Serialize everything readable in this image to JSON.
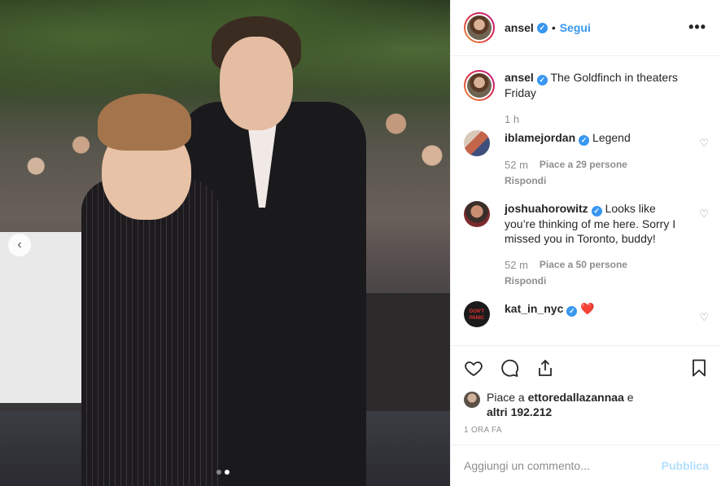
{
  "post": {
    "username": "ansel",
    "verified": true,
    "follow_label": "Segui",
    "bullet": "•",
    "more_label": "•••"
  },
  "caption": {
    "username": "ansel",
    "text": "The Goldfinch in theaters Friday",
    "time": "1 h"
  },
  "comments": [
    {
      "username": "iblamejordan",
      "verified": true,
      "text": "Legend",
      "time": "52 m",
      "likes": "Piace a 29 persone",
      "reply_label": "Rispondi"
    },
    {
      "username": "joshuahorowitz",
      "verified": true,
      "text": "Looks like you’re thinking of me here. Sorry I missed you in Toronto, buddy!",
      "time": "52 m",
      "likes": "Piace a 50 persone",
      "reply_label": "Rispondi"
    },
    {
      "username": "kat_in_nyc",
      "verified": true,
      "text": "❤️",
      "avatar_text": "DON'T PANIC"
    }
  ],
  "likes": {
    "prefix": "Piace a ",
    "user": "ettoredallazannaa",
    "suffix": " e",
    "others": "altri 192.212"
  },
  "posted_time": "1 ora fa",
  "add_comment": {
    "placeholder": "Aggiungi un commento...",
    "publish_label": "Pubblica"
  },
  "colors": {
    "accent": "#3897f0",
    "publish_disabled": "#b2dffc",
    "muted": "#8e8e8e"
  },
  "carousel": {
    "total_slides": 2,
    "active_slide": 2
  }
}
